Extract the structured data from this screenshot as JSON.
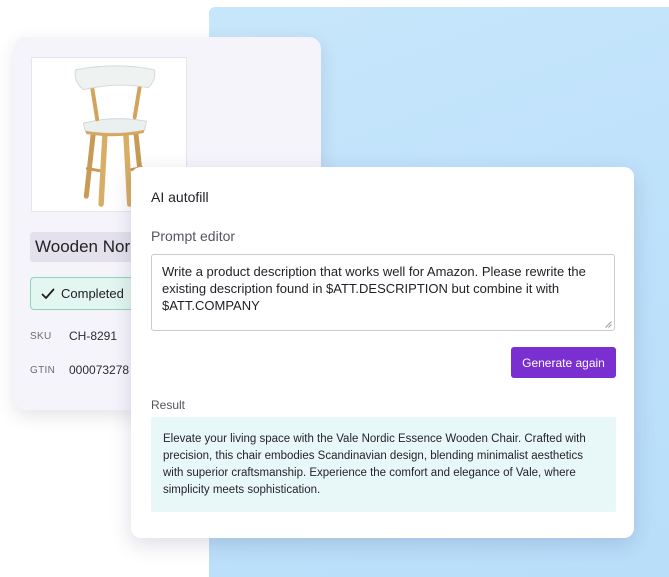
{
  "product": {
    "name": "Wooden Nor",
    "status": "Completed",
    "attributes": [
      {
        "key": "SKU",
        "value": "CH-8291"
      },
      {
        "key": "GTIN",
        "value": "000073278"
      }
    ]
  },
  "ai_autofill": {
    "title": "AI autofill",
    "prompt_label": "Prompt editor",
    "prompt_value": "Write a product description that works well for Amazon. Please rewrite the existing description found in $ATT.DESCRIPTION but combine it with $ATT.COMPANY",
    "generate_label": "Generate again",
    "result_label": "Result",
    "result_text": "Elevate your living space with the Vale Nordic Essence Wooden Chair. Crafted with precision, this chair embodies Scandinavian design, blending minimalist aesthetics with superior craftsmanship. Experience the comfort and elegance of Vale, where simplicity meets sophistication."
  },
  "colors": {
    "accent": "#7a2fd1",
    "status_bg": "#e3f6ef",
    "status_border": "#8fd3bd",
    "result_bg": "#e8f7f7",
    "backdrop": "#bfe2fb"
  },
  "icons": {
    "status": "check-icon",
    "textarea": "resize-handle-icon",
    "product_image": "wooden-chair"
  }
}
